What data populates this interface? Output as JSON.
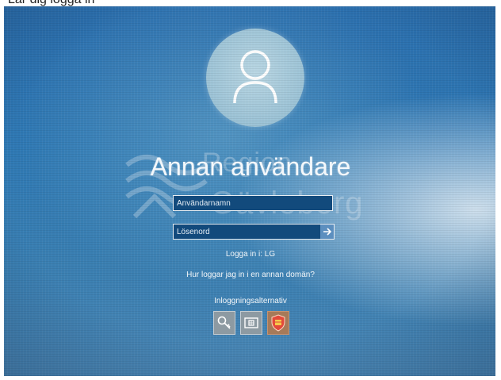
{
  "top_caption": "Lär dig logga in",
  "user": {
    "name": "Annan användare"
  },
  "watermark": {
    "line1": "Region",
    "line2": "Gävleborg"
  },
  "form": {
    "username_placeholder": "Användarnamn",
    "password_placeholder": "Lösenord",
    "submit_icon": "arrow-right-icon"
  },
  "signin_to": "Logga in i: LG",
  "help_link": "Hur loggar jag in i en annan domän?",
  "signin_options": {
    "label": "Inloggningsalternativ",
    "options": [
      {
        "icon": "key-icon",
        "color": "#8d9aa2"
      },
      {
        "icon": "smart-card-icon",
        "color": "#8d9aa2"
      },
      {
        "icon": "shield-icon",
        "color": "#a67a59"
      }
    ]
  },
  "colors": {
    "background_blue": "#2f79b4",
    "field_bg": "#124a7c",
    "text": "#f4f8fb"
  }
}
